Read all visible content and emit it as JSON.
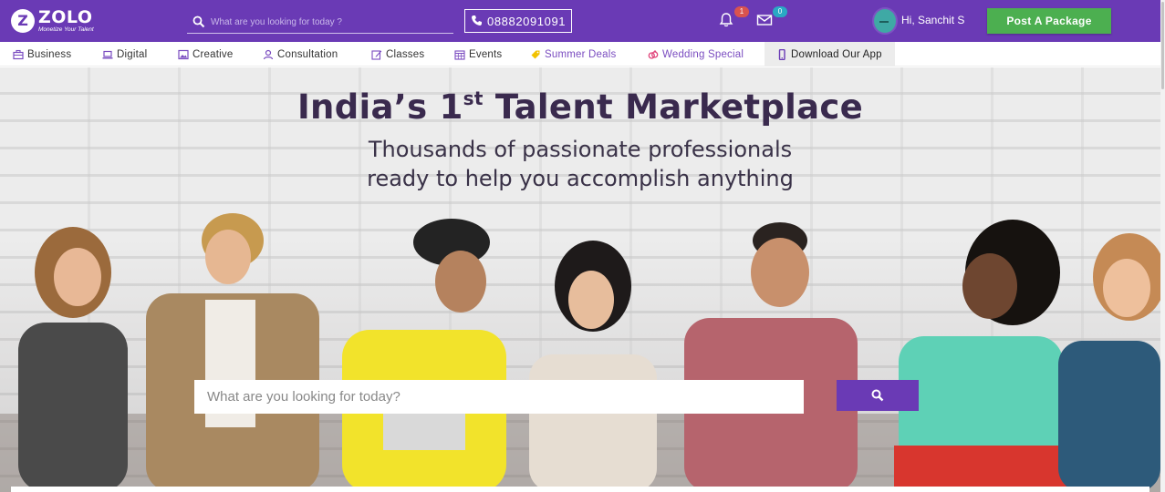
{
  "brand": {
    "logo_letter": "Z",
    "name": "ZOLO",
    "tagline": "Monetize Your Talent",
    "primary_color": "#6a3ab5",
    "accent_green": "#4caf50"
  },
  "header": {
    "search_placeholder": "What are you looking for today ?",
    "phone": "08882091091",
    "notifications_count": "1",
    "messages_count": "0",
    "greeting": "Hi, Sanchit S",
    "post_button": "Post A Package"
  },
  "nav": {
    "items": [
      {
        "label": "Business",
        "icon": "briefcase-icon"
      },
      {
        "label": "Digital",
        "icon": "laptop-icon"
      },
      {
        "label": "Creative",
        "icon": "image-icon"
      },
      {
        "label": "Consultation",
        "icon": "person-icon"
      },
      {
        "label": "Classes",
        "icon": "edit-icon"
      },
      {
        "label": "Events",
        "icon": "calendar-icon"
      },
      {
        "label": "Summer Deals",
        "icon": "tag-icon"
      },
      {
        "label": "Wedding Special",
        "icon": "rings-icon"
      },
      {
        "label": "Download Our App",
        "icon": "mobile-icon"
      }
    ]
  },
  "hero": {
    "title_pre": "India’s 1",
    "title_sup": "st",
    "title_post": " Talent Marketplace",
    "subtitle_line1": "Thousands of passionate professionals",
    "subtitle_line2": "ready to help you accomplish anything",
    "search_placeholder": "What are you looking for today?",
    "search_button_icon": "search-icon"
  }
}
